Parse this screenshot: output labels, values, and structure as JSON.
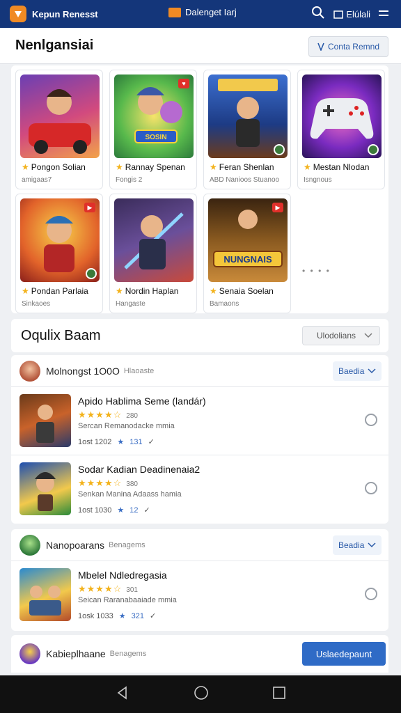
{
  "topbar": {
    "app_title": "Kepun Renesst",
    "center_label": "Dalenget Iarj",
    "right_label": "Elúlali"
  },
  "header": {
    "title": "Nenlgansiai",
    "action_label": "Conta Remnd"
  },
  "featured": [
    {
      "name": "Pongon Solian",
      "sub": "amigaas7"
    },
    {
      "name": "Rannay Spenan",
      "sub": "Fongis 2"
    },
    {
      "name": "Feran Shenlan",
      "sub": "ABD Nanioos Stuanoo"
    },
    {
      "name": "Mestan Nlodan",
      "sub": "Isngnous"
    },
    {
      "name": "Pondan Parlaia",
      "sub": "Sinkaoes"
    },
    {
      "name": "Nordin Haplan",
      "sub": "Hangaste"
    },
    {
      "name": "Senaia Soelan",
      "sub": "Bamaons"
    }
  ],
  "featured_more": "• • • •",
  "featured_banner_text": "NUNGNAIS",
  "featured_button_text": "SOSIN",
  "section": {
    "title": "Oqulix Baam",
    "select_label": "Ulodolians"
  },
  "groups": [
    {
      "title": "Molnongst 1O0O",
      "sub": "Hlaoaste",
      "select_label": "Baedia",
      "items": [
        {
          "title": "Apido Hablima Seme (landár)",
          "stars": "★★★★☆",
          "count": "280",
          "desc": "Sercan Remanodacke mmia",
          "meta_left": "1ost 1202",
          "meta_num": "131"
        },
        {
          "title": "Sodar Kadian Deadinenaia2",
          "stars": "★★★★☆",
          "count": "380",
          "desc": "Senkan Manina Adaass hamia",
          "meta_left": "1ost 1030",
          "meta_num": "12"
        }
      ]
    },
    {
      "title": "Nanopoarans",
      "sub": "Benagems",
      "select_label": "Beadia",
      "items": [
        {
          "title": "Mbelel Ndledregasia",
          "stars": "★★★★☆",
          "count": "301",
          "desc": "Seican Raranabaaiade mmia",
          "meta_left": "1osk 1033",
          "meta_num": "321"
        }
      ]
    }
  ],
  "bottom": {
    "title": "Kabieplhaane",
    "sub": "Benagems",
    "button_label": "Uslaedepaunt"
  },
  "colors": {
    "topbar": "#14367a",
    "accent": "#f08a24",
    "primary": "#2f6bc6",
    "star": "#f3b21a"
  }
}
